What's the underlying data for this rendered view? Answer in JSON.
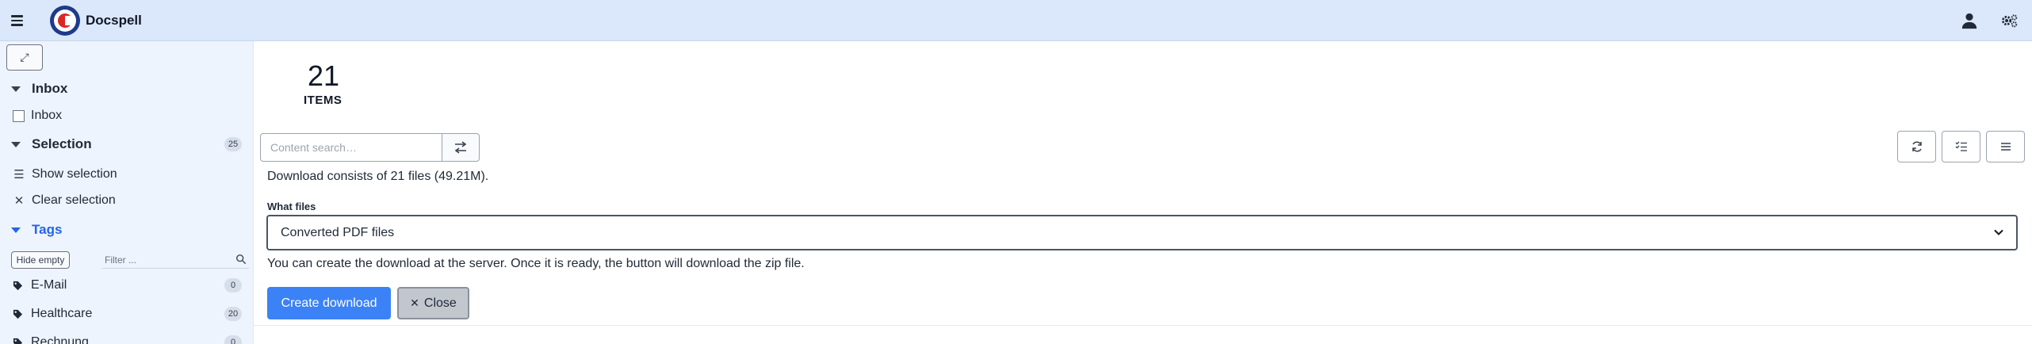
{
  "app": {
    "title": "Docspell"
  },
  "sidebar": {
    "inbox_section": "Inbox",
    "inbox_checkbox": "Inbox",
    "selection_section": "Selection",
    "selection_count": "25",
    "show_selection": "Show selection",
    "clear_selection": "Clear selection",
    "tags_section": "Tags",
    "hide_empty": "Hide empty",
    "filter_placeholder": "Filter ...",
    "tags": [
      {
        "label": "E-Mail",
        "count": "0"
      },
      {
        "label": "Healthcare",
        "count": "20"
      },
      {
        "label": "Rechnung",
        "count": "0"
      }
    ]
  },
  "main": {
    "item_count": "21",
    "item_label": "ITEMS",
    "search_placeholder": "Content search…",
    "download_info": "Download consists of 21 files (49.21M).",
    "what_files_label": "What files",
    "what_files_value": "Converted PDF files",
    "note": "You can create the download at the server. Once it is ready, the button will download the zip file.",
    "create_button": "Create download",
    "close_button": "Close"
  },
  "colors": {
    "topbar": "#dbe8fb",
    "sidebar": "#eef4fd",
    "primary_button": "#3b82f6",
    "tags_accent": "#2563eb"
  },
  "icons": [
    "menu-icon",
    "docspell-logo",
    "user-icon",
    "settings-icon",
    "expand-icon",
    "search-icon",
    "swap-icon",
    "refresh-icon",
    "checklist-icon",
    "list-icon",
    "tag-icon",
    "chevron-down-icon",
    "close-icon"
  ]
}
